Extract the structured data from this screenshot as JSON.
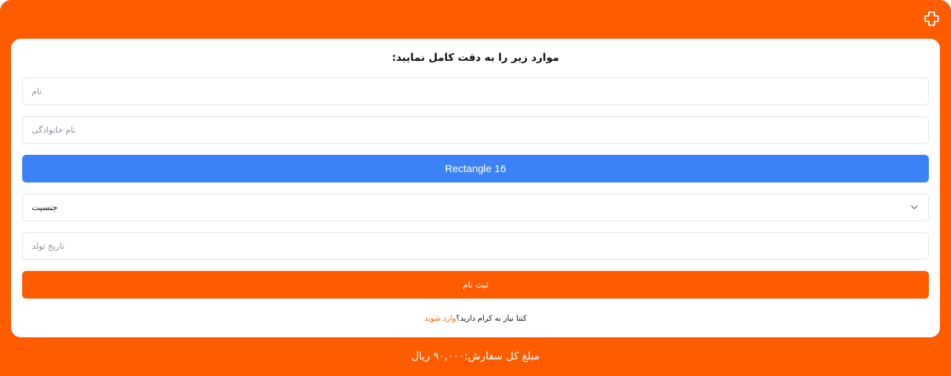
{
  "colors": {
    "brand": "#ff5c00",
    "accent_blue": "#3b82f6",
    "card_bg": "#ffffff",
    "text": "#111111",
    "placeholder": "#8a8f98"
  },
  "header": {
    "add_icon": "plus-icon"
  },
  "form": {
    "title": "موارد زیر را به دقت کامل نمایید:",
    "first_name_placeholder": "نام",
    "last_name_placeholder": "نام خانوادگی",
    "blue_bar_label": "Rectangle 16",
    "gender_value": "جنسیت",
    "gender_icon": "chevron-down-icon",
    "birthdate_placeholder": "تاریخ تولد",
    "submit_label": "ثبت نام"
  },
  "login_prompt": {
    "question": "کنتا نیاز به کرام دارید؟",
    "link": "وارد شوید"
  },
  "footer": {
    "total": "مبلغ کل سفارش:۹۰,۰۰۰ ریال"
  }
}
